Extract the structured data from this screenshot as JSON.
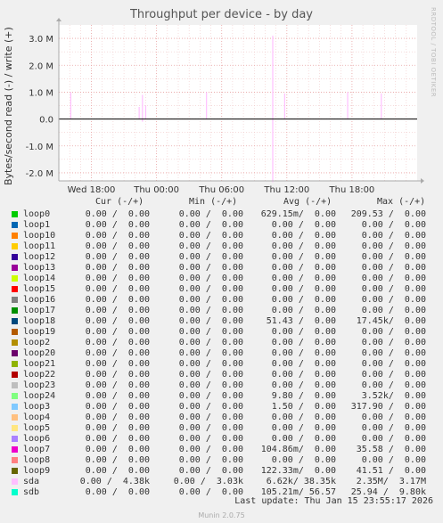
{
  "title": "Throughput per device - by day",
  "ylabel": "Bytes/second read (-) / write (+)",
  "watermark": "RRDTOOL / TOBI OETIKER",
  "legend_headers": {
    "cur": "Cur (-/+)",
    "min": "Min (-/+)",
    "avg": "Avg (-/+)",
    "max": "Max (-/+)"
  },
  "legend": [
    {
      "name": "loop0",
      "color": "#00cc00",
      "cur": "0.00 /  0.00",
      "min": "0.00 /  0.00",
      "avg": "629.15m/  0.00",
      "max": "209.53 /  0.00"
    },
    {
      "name": "loop1",
      "color": "#0066b3",
      "cur": "0.00 /  0.00",
      "min": "0.00 /  0.00",
      "avg": "0.00 /  0.00",
      "max": "0.00 /  0.00"
    },
    {
      "name": "loop10",
      "color": "#ff8000",
      "cur": "0.00 /  0.00",
      "min": "0.00 /  0.00",
      "avg": "0.00 /  0.00",
      "max": "0.00 /  0.00"
    },
    {
      "name": "loop11",
      "color": "#ffcc00",
      "cur": "0.00 /  0.00",
      "min": "0.00 /  0.00",
      "avg": "0.00 /  0.00",
      "max": "0.00 /  0.00"
    },
    {
      "name": "loop12",
      "color": "#330099",
      "cur": "0.00 /  0.00",
      "min": "0.00 /  0.00",
      "avg": "0.00 /  0.00",
      "max": "0.00 /  0.00"
    },
    {
      "name": "loop13",
      "color": "#990099",
      "cur": "0.00 /  0.00",
      "min": "0.00 /  0.00",
      "avg": "0.00 /  0.00",
      "max": "0.00 /  0.00"
    },
    {
      "name": "loop14",
      "color": "#ccff00",
      "cur": "0.00 /  0.00",
      "min": "0.00 /  0.00",
      "avg": "0.00 /  0.00",
      "max": "0.00 /  0.00"
    },
    {
      "name": "loop15",
      "color": "#ff0000",
      "cur": "0.00 /  0.00",
      "min": "0.00 /  0.00",
      "avg": "0.00 /  0.00",
      "max": "0.00 /  0.00"
    },
    {
      "name": "loop16",
      "color": "#808080",
      "cur": "0.00 /  0.00",
      "min": "0.00 /  0.00",
      "avg": "0.00 /  0.00",
      "max": "0.00 /  0.00"
    },
    {
      "name": "loop17",
      "color": "#008f00",
      "cur": "0.00 /  0.00",
      "min": "0.00 /  0.00",
      "avg": "0.00 /  0.00",
      "max": "0.00 /  0.00"
    },
    {
      "name": "loop18",
      "color": "#00487d",
      "cur": "0.00 /  0.00",
      "min": "0.00 /  0.00",
      "avg": "51.43 /  0.00",
      "max": "17.45k/  0.00"
    },
    {
      "name": "loop19",
      "color": "#b35a00",
      "cur": "0.00 /  0.00",
      "min": "0.00 /  0.00",
      "avg": "0.00 /  0.00",
      "max": "0.00 /  0.00"
    },
    {
      "name": "loop2",
      "color": "#b38f00",
      "cur": "0.00 /  0.00",
      "min": "0.00 /  0.00",
      "avg": "0.00 /  0.00",
      "max": "0.00 /  0.00"
    },
    {
      "name": "loop20",
      "color": "#6b006b",
      "cur": "0.00 /  0.00",
      "min": "0.00 /  0.00",
      "avg": "0.00 /  0.00",
      "max": "0.00 /  0.00"
    },
    {
      "name": "loop21",
      "color": "#8fb300",
      "cur": "0.00 /  0.00",
      "min": "0.00 /  0.00",
      "avg": "0.00 /  0.00",
      "max": "0.00 /  0.00"
    },
    {
      "name": "loop22",
      "color": "#b30000",
      "cur": "0.00 /  0.00",
      "min": "0.00 /  0.00",
      "avg": "0.00 /  0.00",
      "max": "0.00 /  0.00"
    },
    {
      "name": "loop23",
      "color": "#bebebe",
      "cur": "0.00 /  0.00",
      "min": "0.00 /  0.00",
      "avg": "0.00 /  0.00",
      "max": "0.00 /  0.00"
    },
    {
      "name": "loop24",
      "color": "#80ff80",
      "cur": "0.00 /  0.00",
      "min": "0.00 /  0.00",
      "avg": "9.80 /  0.00",
      "max": "3.52k/  0.00"
    },
    {
      "name": "loop3",
      "color": "#80c9ff",
      "cur": "0.00 /  0.00",
      "min": "0.00 /  0.00",
      "avg": "1.50 /  0.00",
      "max": "317.90 /  0.00"
    },
    {
      "name": "loop4",
      "color": "#ffc080",
      "cur": "0.00 /  0.00",
      "min": "0.00 /  0.00",
      "avg": "0.00 /  0.00",
      "max": "0.00 /  0.00"
    },
    {
      "name": "loop5",
      "color": "#ffe680",
      "cur": "0.00 /  0.00",
      "min": "0.00 /  0.00",
      "avg": "0.00 /  0.00",
      "max": "0.00 /  0.00"
    },
    {
      "name": "loop6",
      "color": "#aa80ff",
      "cur": "0.00 /  0.00",
      "min": "0.00 /  0.00",
      "avg": "0.00 /  0.00",
      "max": "0.00 /  0.00"
    },
    {
      "name": "loop7",
      "color": "#ee00cc",
      "cur": "0.00 /  0.00",
      "min": "0.00 /  0.00",
      "avg": "104.86m/  0.00",
      "max": "35.58 /  0.00"
    },
    {
      "name": "loop8",
      "color": "#ff8080",
      "cur": "0.00 /  0.00",
      "min": "0.00 /  0.00",
      "avg": "0.00 /  0.00",
      "max": "0.00 /  0.00"
    },
    {
      "name": "loop9",
      "color": "#666600",
      "cur": "0.00 /  0.00",
      "min": "0.00 /  0.00",
      "avg": "122.33m/  0.00",
      "max": "41.51 /  0.00"
    },
    {
      "name": "sda",
      "color": "#ffbfff",
      "cur": "0.00 /  4.38k",
      "min": "0.00 /  3.03k",
      "avg": "6.62k/ 38.35k",
      "max": "2.35M/  3.17M"
    },
    {
      "name": "sdb",
      "color": "#00ffcc",
      "cur": "0.00 /  0.00",
      "min": "0.00 /  0.00",
      "avg": "105.21m/ 56.57",
      "max": "25.94 /  9.80k"
    }
  ],
  "last_update": "Last update: Thu Jan 15 23:55:17 2026",
  "munin_version": "Munin 2.0.75",
  "chart_data": {
    "type": "line",
    "title": "Throughput per device - by day",
    "ylabel": "Bytes/second read (-) / write (+)",
    "ylim": [
      -2300000,
      3500000
    ],
    "yticks": [
      {
        "value": 3000000,
        "label": "3.0 M"
      },
      {
        "value": 2000000,
        "label": "2.0 M"
      },
      {
        "value": 1000000,
        "label": "1.0 M"
      },
      {
        "value": 0,
        "label": "0.0"
      },
      {
        "value": -1000000,
        "label": "-1.0 M"
      },
      {
        "value": -2000000,
        "label": "-2.0 M"
      }
    ],
    "xlim_hours": [
      -33,
      0
    ],
    "xticks": [
      {
        "hour": -30,
        "label": "Wed 18:00"
      },
      {
        "hour": -24,
        "label": "Thu 00:00"
      },
      {
        "hour": -18,
        "label": "Thu 06:00"
      },
      {
        "hour": -12,
        "label": "Thu 12:00"
      },
      {
        "hour": -6,
        "label": "Thu 18:00"
      }
    ],
    "grid": true,
    "series": [
      {
        "name": "sda",
        "color": "#ffbfff",
        "write_spikes": [
          {
            "hour": -31.9,
            "value": 1000000
          },
          {
            "hour": -25.6,
            "value": 450000
          },
          {
            "hour": -25.3,
            "value": 900000
          },
          {
            "hour": -25.0,
            "value": 500000
          },
          {
            "hour": -19.4,
            "value": 1000000
          },
          {
            "hour": -13.3,
            "value": 3100000
          },
          {
            "hour": -12.2,
            "value": 950000
          },
          {
            "hour": -6.4,
            "value": 1000000
          },
          {
            "hour": -3.3,
            "value": 950000
          }
        ],
        "read_spikes": [
          {
            "hour": -13.3,
            "value": -2350000
          },
          {
            "hour": -25.3,
            "value": -100000
          }
        ]
      },
      {
        "name": "sdb",
        "color": "#00ffcc",
        "write_spikes": [],
        "read_spikes": []
      }
    ]
  }
}
